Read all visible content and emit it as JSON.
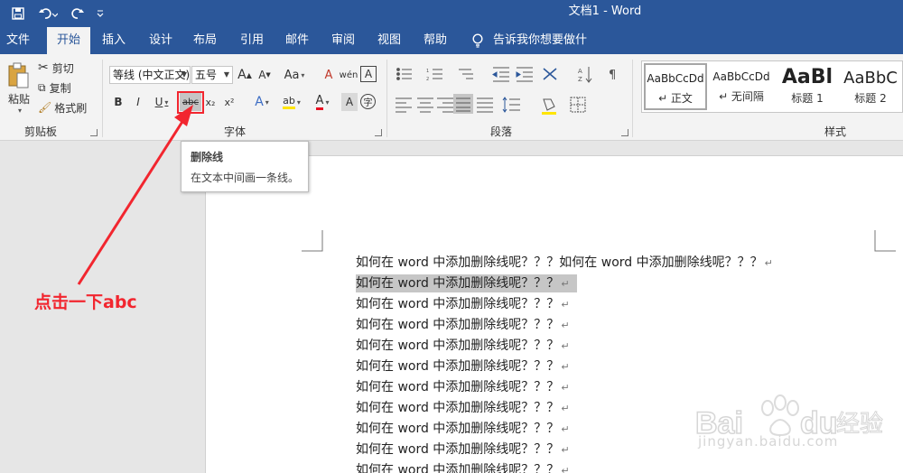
{
  "window": {
    "title": "文档1 - Word"
  },
  "tabs": [
    {
      "label": "文件",
      "active": false
    },
    {
      "label": "开始",
      "active": true
    },
    {
      "label": "插入",
      "active": false
    },
    {
      "label": "设计",
      "active": false
    },
    {
      "label": "布局",
      "active": false
    },
    {
      "label": "引用",
      "active": false
    },
    {
      "label": "邮件",
      "active": false
    },
    {
      "label": "审阅",
      "active": false
    },
    {
      "label": "视图",
      "active": false
    },
    {
      "label": "帮助",
      "active": false
    }
  ],
  "tell_me": "告诉我你想要做什么",
  "clipboard": {
    "paste": "粘贴",
    "cut": "剪切",
    "copy": "复制",
    "format_painter": "格式刷",
    "group_label": "剪贴板"
  },
  "font": {
    "font_name": "等线 (中文正文)",
    "font_size": "五号",
    "grow": "A",
    "shrink": "A",
    "change_case": "Aa",
    "clear_format": "A",
    "phonetic": "wén",
    "char_border": "A",
    "bold": "B",
    "italic": "I",
    "underline": "U",
    "strikethrough": "abc",
    "subscript": "x₂",
    "superscript": "x²",
    "text_effects": "A",
    "highlight": "ab",
    "font_color": "A",
    "char_shading": "A",
    "enclose": "字",
    "group_label": "字体"
  },
  "paragraph": {
    "group_label": "段落"
  },
  "styles": {
    "items": [
      {
        "sample": "AaBbCcDd",
        "name": "↵ 正文",
        "selected": true
      },
      {
        "sample": "AaBbCcDd",
        "name": "↵ 无间隔",
        "selected": false
      },
      {
        "sample": "AaBl",
        "name": "标题 1",
        "selected": false
      },
      {
        "sample": "AaBbC",
        "name": "标题 2",
        "selected": false
      }
    ],
    "group_label": "样式"
  },
  "tooltip": {
    "title": "删除线",
    "description": "在文本中间画一条线。"
  },
  "document": {
    "lines": [
      {
        "text": "如何在 word 中添加删除线呢？？？如何在 word 中添加删除线呢？？？",
        "highlighted": false
      },
      {
        "text": "如何在 word 中添加删除线呢？？？",
        "highlighted": true
      },
      {
        "text": "如何在 word 中添加删除线呢？？？",
        "highlighted": false
      },
      {
        "text": "如何在 word 中添加删除线呢？？？",
        "highlighted": false
      },
      {
        "text": "如何在 word 中添加删除线呢？？？",
        "highlighted": false
      },
      {
        "text": "如何在 word 中添加删除线呢？？？",
        "highlighted": false
      },
      {
        "text": "如何在 word 中添加删除线呢？？？",
        "highlighted": false
      },
      {
        "text": "如何在 word 中添加删除线呢？？？",
        "highlighted": false
      },
      {
        "text": "如何在 word 中添加删除线呢？？？",
        "highlighted": false
      },
      {
        "text": "如何在 word 中添加删除线呢？？？",
        "highlighted": false
      },
      {
        "text": "如何在 word 中添加删除线呢？？？",
        "highlighted": false
      }
    ],
    "paragraph_mark": "↵"
  },
  "annotation": {
    "text": "点击一下abc",
    "color": "#f2262f"
  },
  "watermark": {
    "brand": "Baidu经验",
    "url": "jingyan.baidu.com"
  },
  "colors": {
    "accent": "#2b579a",
    "ribbon": "#f3f3f3",
    "highlight": "#c6c6c6"
  }
}
